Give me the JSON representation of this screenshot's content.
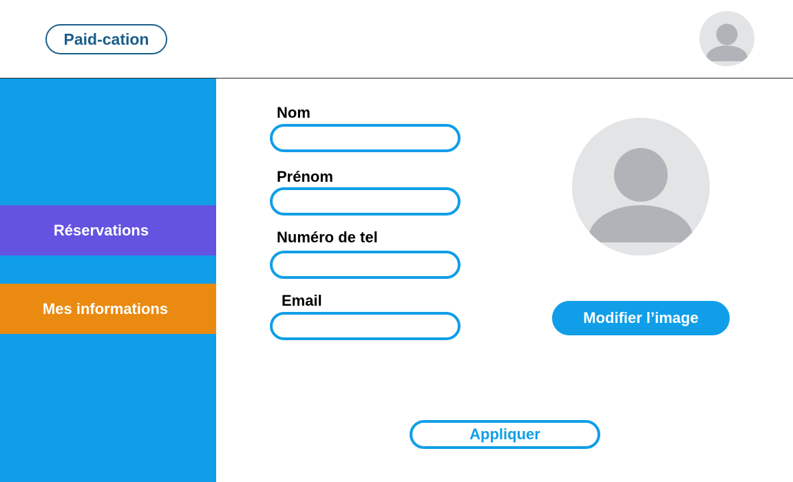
{
  "header": {
    "brand_label": "Paid-cation",
    "avatar_icon": "user-avatar-icon"
  },
  "sidebar": {
    "background": "#109ee8",
    "items": [
      {
        "label": "Réservations",
        "color": "#6353e0"
      },
      {
        "label": "Mes informations",
        "color": "#ea8a10",
        "active": true
      }
    ]
  },
  "form": {
    "fields": [
      {
        "label": "Nom",
        "value": ""
      },
      {
        "label": "Prénom",
        "value": ""
      },
      {
        "label": "Numéro de tel",
        "value": ""
      },
      {
        "label": "Email",
        "value": ""
      }
    ],
    "apply_label": "Appliquer"
  },
  "profile_image": {
    "icon": "user-avatar-icon",
    "modify_label": "Modifier l’image"
  },
  "colors": {
    "accent": "#109ee8",
    "brand": "#1a5e8a",
    "avatar_bg": "#e3e4e6",
    "avatar_fg": "#b0b4b8"
  }
}
